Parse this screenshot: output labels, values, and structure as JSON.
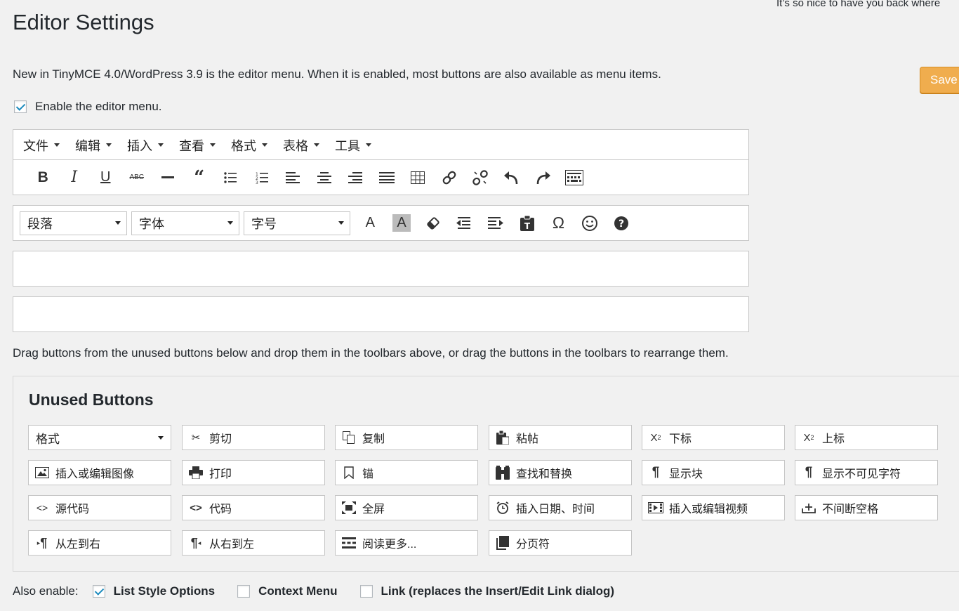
{
  "header": {
    "greeting": "It’s so nice to have you back where",
    "title": "Editor Settings",
    "save_label": "Save"
  },
  "intro_text": "New in TinyMCE 4.0/WordPress 3.9 is the editor menu. When it is enabled, most buttons are also available as menu items.",
  "enable_menu": {
    "label": "Enable the editor menu.",
    "checked": true
  },
  "editor_menu": [
    "文件",
    "编辑",
    "插入",
    "查看",
    "格式",
    "表格",
    "工具"
  ],
  "toolbar1_icons": [
    "bold-icon",
    "italic-icon",
    "underline-icon",
    "strikethrough-icon",
    "horizontal-rule-icon",
    "blockquote-icon",
    "bullet-list-icon",
    "numbered-list-icon",
    "align-left-icon",
    "align-center-icon",
    "align-right-icon",
    "align-justify-icon",
    "table-icon",
    "link-icon",
    "unlink-icon",
    "undo-icon",
    "redo-icon",
    "keyboard-icon"
  ],
  "toolbar2": {
    "paragraph": "段落",
    "font_family": "字体",
    "font_size": "字号",
    "icons": [
      "text-color-icon",
      "background-color-icon",
      "eraser-icon",
      "outdent-icon",
      "indent-icon",
      "paste-text-icon",
      "omega-icon",
      "emoticon-icon",
      "help-icon"
    ]
  },
  "drag_note": "Drag buttons from the unused buttons below and drop them in the toolbars above, or drag the buttons in the toolbars to rearrange them.",
  "unused": {
    "title": "Unused Buttons",
    "format_label": "格式",
    "buttons": [
      {
        "label": "剪切",
        "icon": "scissors-icon"
      },
      {
        "label": "复制",
        "icon": "copy-icon"
      },
      {
        "label": "粘帖",
        "icon": "clipboard-icon"
      },
      {
        "label": "下标",
        "icon": "subscript-icon"
      },
      {
        "label": "上标",
        "icon": "superscript-icon"
      },
      {
        "label": "插入或编辑图像",
        "icon": "image-icon"
      },
      {
        "label": "打印",
        "icon": "print-icon"
      },
      {
        "label": "锚",
        "icon": "bookmark-icon"
      },
      {
        "label": "查找和替换",
        "icon": "binoculars-icon"
      },
      {
        "label": "显示块",
        "icon": "pilcrow-icon"
      },
      {
        "label": "显示不可见字符",
        "icon": "pilcrow-icon"
      },
      {
        "label": "源代码",
        "icon": "code-icon"
      },
      {
        "label": "代码",
        "icon": "code-bold-icon"
      },
      {
        "label": "全屏",
        "icon": "fullscreen-icon"
      },
      {
        "label": "插入日期、时间",
        "icon": "clock-icon"
      },
      {
        "label": "插入或编辑视频",
        "icon": "video-icon"
      },
      {
        "label": "不间断空格",
        "icon": "nbsp-icon"
      },
      {
        "label": "从左到右",
        "icon": "ltr-icon"
      },
      {
        "label": "从右到左",
        "icon": "rtl-icon"
      },
      {
        "label": "阅读更多...",
        "icon": "read-more-icon"
      },
      {
        "label": "分页符",
        "icon": "page-break-icon"
      }
    ]
  },
  "also_enable": {
    "label": "Also enable:",
    "options": [
      {
        "label": "List Style Options",
        "checked": true
      },
      {
        "label": "Context Menu",
        "checked": false
      },
      {
        "label": "Link (replaces the Insert/Edit Link dialog)",
        "checked": false
      }
    ]
  },
  "colors": {
    "accent": "#1e8cbe",
    "save_button": "#f0ad4e",
    "background": "#f1f1f1"
  }
}
